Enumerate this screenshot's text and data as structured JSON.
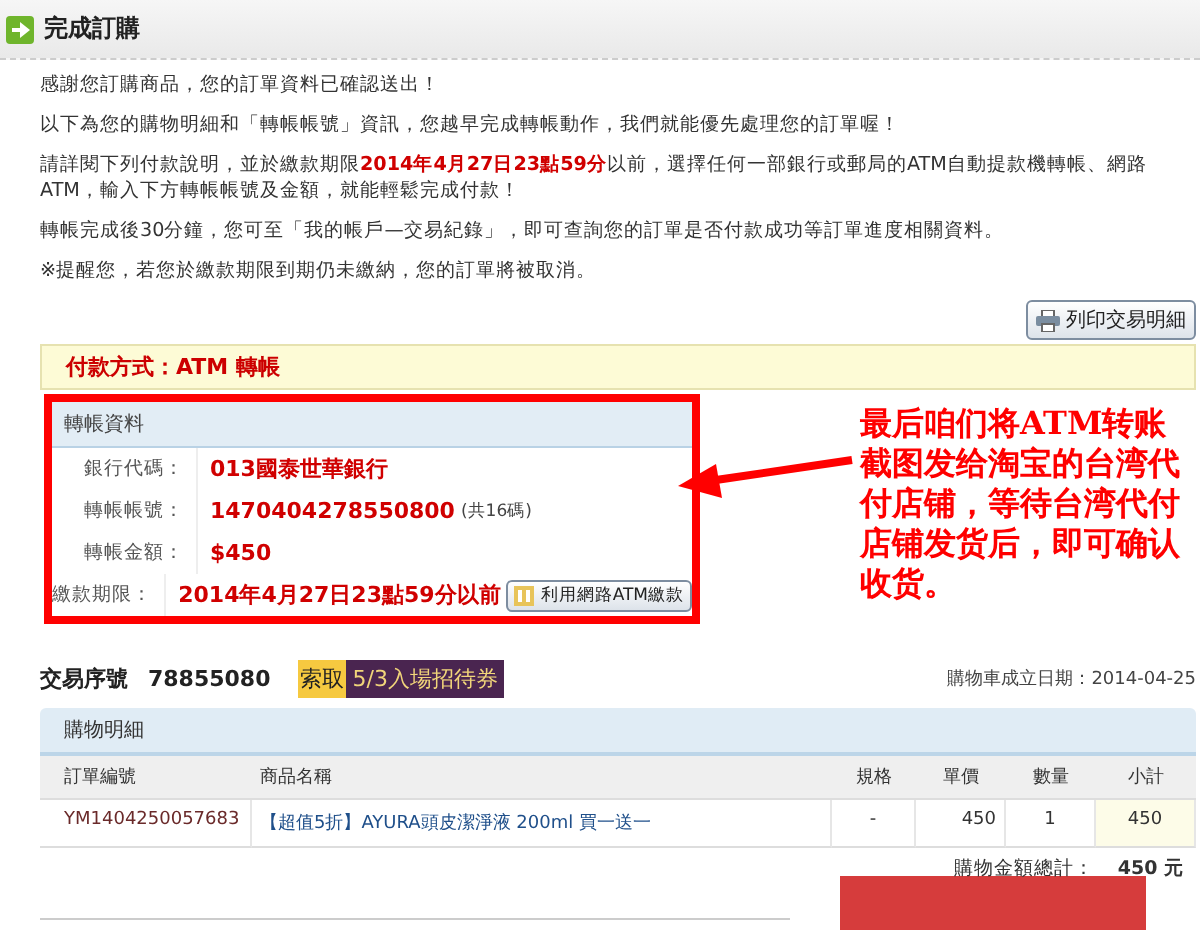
{
  "header": {
    "title": "完成訂購"
  },
  "intro": [
    "感謝您訂購商品，您的訂單資料已確認送出！",
    "以下為您的購物明細和「轉帳帳號」資訊，您越早完成轉帳動作，我們就能優先處理您的訂單喔！",
    "請詳閱下列付款說明，並於繳款期限**2014年4月27日23點59分**以前，選擇任何一部銀行或郵局的ATM自動提款機轉帳、網路ATM，輸入下方轉帳帳號及金額，就能輕鬆完成付款！",
    "轉帳完成後30分鐘，您可至「我的帳戶—交易紀錄」，即可查詢您的訂單是否付款成功等訂單進度相關資料。",
    "※提醒您，若您於繳款期限到期仍未繳納，您的訂單將被取消。"
  ],
  "print_button": {
    "label": "列印交易明細"
  },
  "payment_method": "付款方式：ATM 轉帳",
  "transfer": {
    "title": "轉帳資料",
    "rows": [
      {
        "label": "銀行代碼：",
        "value": "013國泰世華銀行"
      },
      {
        "label": "轉帳帳號：",
        "value": "1470404278550800",
        "note": "(共16碼)"
      },
      {
        "label": "轉帳金額：",
        "value": "$450"
      },
      {
        "label": "繳款期限：",
        "value": "2014年4月27日23點59分以前",
        "button": "利用網路ATM繳款"
      }
    ]
  },
  "annotation": {
    "text": "最后咱们将ATM转账截图发给淘宝的台湾代付店铺，等待台湾代付店铺发货后，即可确认收货。"
  },
  "transaction": {
    "label": "交易序號",
    "number": "78855080",
    "promo": {
      "tag": "索取",
      "title": "5/3入場招待券"
    },
    "cart_date": "購物車成立日期：2014-04-25"
  },
  "order": {
    "title": "購物明細",
    "columns": [
      "訂單編號",
      "商品名稱",
      "規格",
      "單價",
      "數量",
      "小計"
    ],
    "rows": [
      {
        "cells": [
          "YM1404250057683",
          "【超值5折】AYURA頭皮潔淨液 200ml 買一送一",
          "-",
          "450",
          "1",
          "450"
        ]
      }
    ],
    "total_label": "購物金額總計：",
    "total_value": "450 元"
  }
}
